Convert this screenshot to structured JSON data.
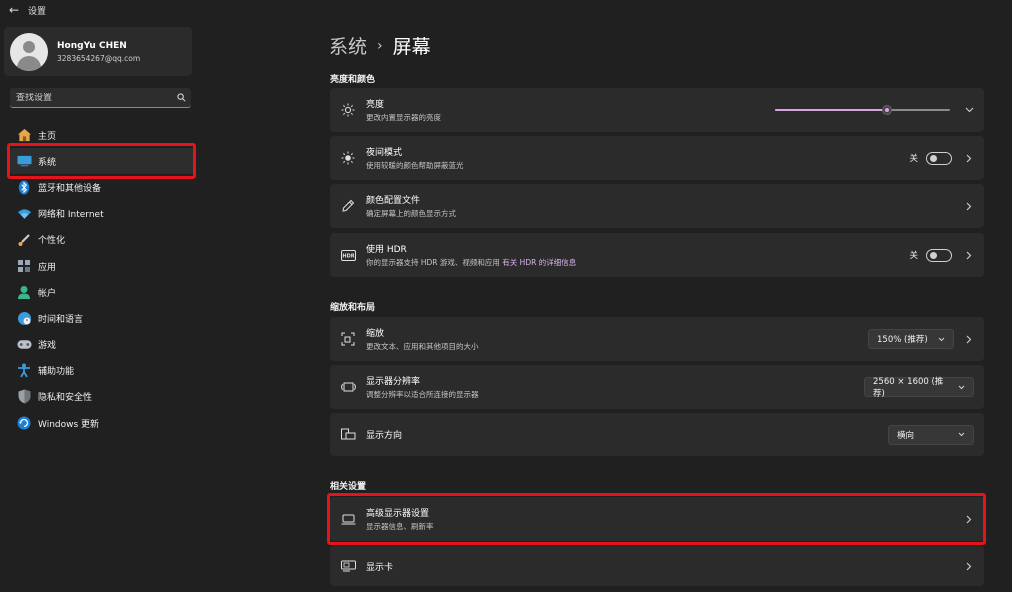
{
  "window": {
    "title": "设置"
  },
  "profile": {
    "name": "HongYu CHEN",
    "email": "3283654267@qq.com"
  },
  "search": {
    "placeholder": "查找设置"
  },
  "nav": [
    {
      "label": "主页",
      "icon": "home-icon"
    },
    {
      "label": "系统",
      "icon": "system-icon",
      "active": true
    },
    {
      "label": "蓝牙和其他设备",
      "icon": "bluetooth-icon"
    },
    {
      "label": "网络和 Internet",
      "icon": "wifi-icon"
    },
    {
      "label": "个性化",
      "icon": "brush-icon"
    },
    {
      "label": "应用",
      "icon": "apps-icon"
    },
    {
      "label": "帐户",
      "icon": "account-icon"
    },
    {
      "label": "时间和语言",
      "icon": "globe-clock-icon"
    },
    {
      "label": "游戏",
      "icon": "gamepad-icon"
    },
    {
      "label": "辅助功能",
      "icon": "accessibility-icon"
    },
    {
      "label": "隐私和安全性",
      "icon": "shield-icon"
    },
    {
      "label": "Windows 更新",
      "icon": "update-icon"
    }
  ],
  "breadcrumb": {
    "parent": "系统",
    "separator": "›",
    "current": "屏幕"
  },
  "sections": {
    "brightness_color": "亮度和颜色",
    "scale_layout": "缩放和布局",
    "related": "相关设置"
  },
  "brightness": {
    "title": "亮度",
    "subtitle": "更改内置显示器的亮度",
    "value_percent": 64
  },
  "night_light": {
    "title": "夜间模式",
    "subtitle": "使用较暖的颜色帮助屏蔽蓝光",
    "state": "关"
  },
  "color_profile": {
    "title": "颜色配置文件",
    "subtitle": "确定屏幕上的颜色显示方式"
  },
  "hdr": {
    "title": "使用 HDR",
    "subtitle": "你的显示器支持 HDR 游戏、视频和应用",
    "link": "有关 HDR 的详细信息",
    "state": "关"
  },
  "scale": {
    "title": "缩放",
    "subtitle": "更改文本、应用和其他项目的大小",
    "value": "150% (推荐)"
  },
  "resolution": {
    "title": "显示器分辨率",
    "subtitle": "调整分辨率以适合所连接的显示器",
    "value": "2560 × 1600 (推荐)"
  },
  "orientation": {
    "title": "显示方向",
    "value": "横向"
  },
  "advanced_display": {
    "title": "高级显示器设置",
    "subtitle": "显示器信息、刷新率"
  },
  "graphics": {
    "title": "显示卡"
  },
  "colors": {
    "accent": "#d9a3e4",
    "highlight": "#e5141a",
    "background": "#202020",
    "card": "#2b2b2b"
  }
}
